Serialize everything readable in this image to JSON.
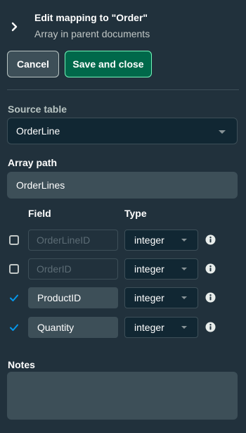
{
  "header": {
    "title": "Edit mapping to \"Order\"",
    "subtitle": "Array in parent documents"
  },
  "actions": {
    "cancel_label": "Cancel",
    "save_label": "Save and close"
  },
  "source_table": {
    "label": "Source table",
    "value": "OrderLine"
  },
  "array_path": {
    "label": "Array path",
    "value": "OrderLines"
  },
  "fields_table": {
    "columns": {
      "field": "Field",
      "type": "Type"
    },
    "rows": [
      {
        "checked": false,
        "field": "OrderLineID",
        "type": "integer"
      },
      {
        "checked": false,
        "field": "OrderID",
        "type": "integer"
      },
      {
        "checked": true,
        "field": "ProductID",
        "type": "integer"
      },
      {
        "checked": true,
        "field": "Quantity",
        "type": "integer"
      }
    ]
  },
  "notes": {
    "label": "Notes",
    "value": ""
  },
  "colors": {
    "panel_bg": "#21313c",
    "primary_button": "#00684a",
    "primary_border": "#71f6ba",
    "checkbox_checked": "#0498ec"
  },
  "icons": {
    "expand": "chevron-right-icon",
    "info": "info-icon",
    "caret": "caret-down-icon",
    "check": "check-icon"
  }
}
